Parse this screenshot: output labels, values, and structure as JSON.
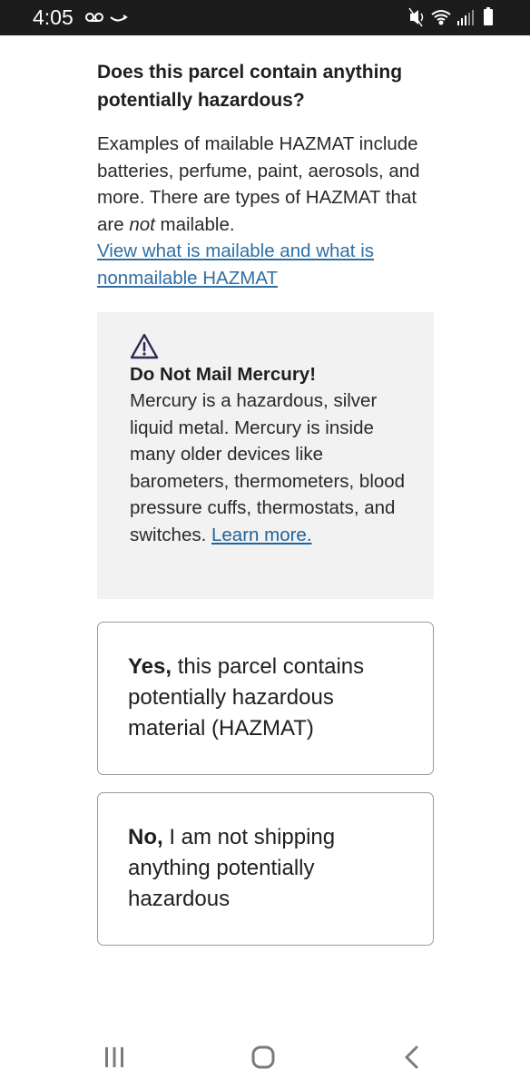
{
  "status_bar": {
    "time": "4:05",
    "left_icons": [
      "voicemail-icon",
      "amazon-smile-icon"
    ],
    "right_icons": [
      "mute-icon",
      "wifi-icon",
      "signal-icon",
      "battery-icon"
    ]
  },
  "content": {
    "question": "Does this parcel contain anything potentially hazardous?",
    "intro_text_1": "Examples of mailable HAZMAT include batteries, perfume, paint, aerosols, and more. There are types of HAZMAT that are ",
    "intro_text_em": "not",
    "intro_text_2": " mailable.",
    "intro_link": "View what is mailable and what is nonmailable HAZMAT"
  },
  "warning": {
    "icon": "warning-triangle-icon",
    "title": "Do Not Mail Mercury!",
    "body": "Mercury is a hazardous, silver liquid metal. Mercury is inside many older devices like barometers, thermometers, blood pressure cuffs, thermostats, and switches. ",
    "link": "Learn more."
  },
  "options": {
    "yes": {
      "bold": "Yes,",
      "text": " this parcel contains potentially hazardous material (HAZMAT)"
    },
    "no": {
      "bold": "No,",
      "text": " I am not shipping anything potentially hazardous"
    }
  },
  "nav_bar": {
    "buttons": [
      "recent-apps-icon",
      "home-icon",
      "back-icon"
    ]
  },
  "colors": {
    "link": "#2f6fa3",
    "warning_bg": "#f2f2f2",
    "option_border": "#9a9a9a",
    "status_bar_bg": "#1c1c1c"
  }
}
